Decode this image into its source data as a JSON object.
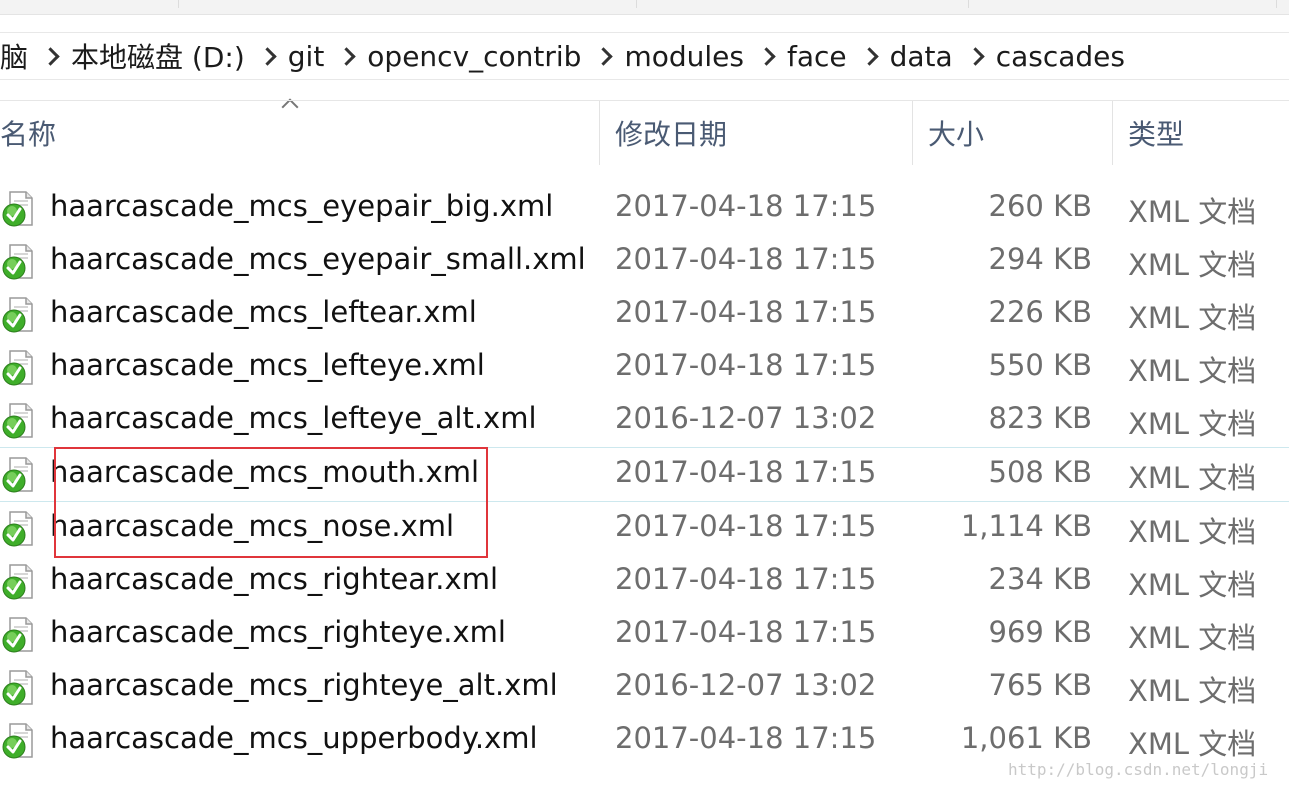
{
  "breadcrumb": [
    "脑",
    "本地磁盘 (D:)",
    "git",
    "opencv_contrib",
    "modules",
    "face",
    "data",
    "cascades"
  ],
  "columns": {
    "name": "名称",
    "date": "修改日期",
    "size": "大小",
    "type": "类型"
  },
  "files": [
    {
      "name": "haarcascade_mcs_eyepair_big.xml",
      "date": "2017-04-18 17:15",
      "size": "260 KB",
      "type": "XML 文档"
    },
    {
      "name": "haarcascade_mcs_eyepair_small.xml",
      "date": "2017-04-18 17:15",
      "size": "294 KB",
      "type": "XML 文档"
    },
    {
      "name": "haarcascade_mcs_leftear.xml",
      "date": "2017-04-18 17:15",
      "size": "226 KB",
      "type": "XML 文档"
    },
    {
      "name": "haarcascade_mcs_lefteye.xml",
      "date": "2017-04-18 17:15",
      "size": "550 KB",
      "type": "XML 文档"
    },
    {
      "name": "haarcascade_mcs_lefteye_alt.xml",
      "date": "2016-12-07 13:02",
      "size": "823 KB",
      "type": "XML 文档"
    },
    {
      "name": "haarcascade_mcs_mouth.xml",
      "date": "2017-04-18 17:15",
      "size": "508 KB",
      "type": "XML 文档"
    },
    {
      "name": "haarcascade_mcs_nose.xml",
      "date": "2017-04-18 17:15",
      "size": "1,114 KB",
      "type": "XML 文档"
    },
    {
      "name": "haarcascade_mcs_rightear.xml",
      "date": "2017-04-18 17:15",
      "size": "234 KB",
      "type": "XML 文档"
    },
    {
      "name": "haarcascade_mcs_righteye.xml",
      "date": "2017-04-18 17:15",
      "size": "969 KB",
      "type": "XML 文档"
    },
    {
      "name": "haarcascade_mcs_righteye_alt.xml",
      "date": "2016-12-07 13:02",
      "size": "765 KB",
      "type": "XML 文档"
    },
    {
      "name": "haarcascade_mcs_upperbody.xml",
      "date": "2017-04-18 17:15",
      "size": "1,061 KB",
      "type": "XML 文档"
    }
  ],
  "icons": {
    "file": "xml-file-icon",
    "separator": "chevron-right-icon",
    "sort": "sort-up-icon"
  },
  "colors": {
    "highlight_box": "#e0353b",
    "header_text": "#4a5a73"
  },
  "watermark": "http://blog.csdn.net/longji"
}
